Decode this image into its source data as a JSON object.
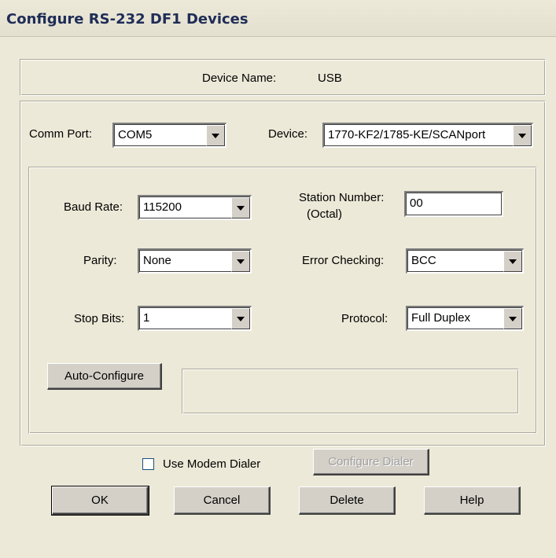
{
  "window": {
    "title": "Configure RS-232 DF1 Devices"
  },
  "device_name": {
    "label": "Device Name:",
    "value": "USB"
  },
  "comm_port": {
    "label": "Comm Port:",
    "value": "COM5"
  },
  "device": {
    "label": "Device:",
    "value": "1770-KF2/1785-KE/SCANport"
  },
  "baud_rate": {
    "label": "Baud Rate:",
    "value": "115200"
  },
  "station_number": {
    "label_line1": "Station Number:",
    "label_line2": "(Octal)",
    "value": "00"
  },
  "parity": {
    "label": "Parity:",
    "value": "None"
  },
  "error_checking": {
    "label": "Error Checking:",
    "value": "BCC"
  },
  "stop_bits": {
    "label": "Stop Bits:",
    "value": "1"
  },
  "protocol": {
    "label": "Protocol:",
    "value": "Full Duplex"
  },
  "auto_configure": {
    "label": "Auto-Configure",
    "status_text": ""
  },
  "modem": {
    "checkbox_label": "Use Modem Dialer",
    "checked": false,
    "configure_label": "Configure Dialer"
  },
  "buttons": {
    "ok": "OK",
    "cancel": "Cancel",
    "delete": "Delete",
    "help": "Help"
  }
}
